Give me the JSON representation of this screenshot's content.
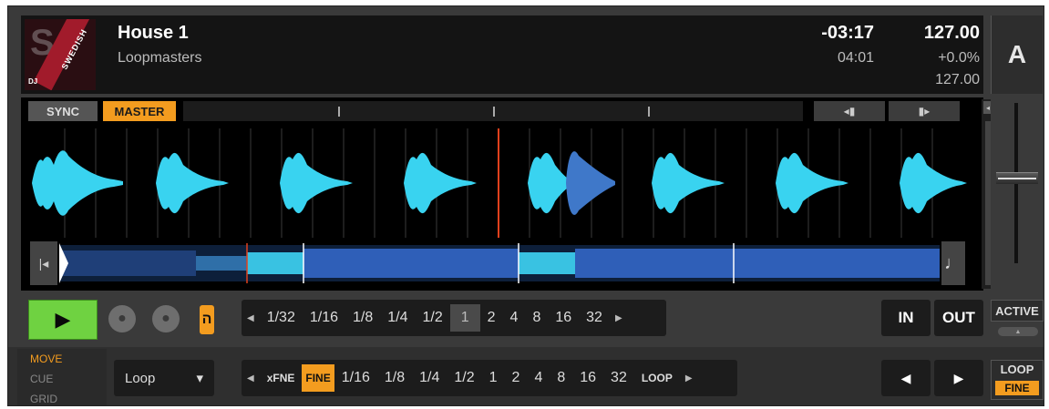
{
  "track": {
    "title": "House 1",
    "artist": "Loopmasters",
    "remaining": "-03:17",
    "elapsed": "04:01",
    "bpm": "127.00",
    "pitch": "+0.0%",
    "base_bpm": "127.00",
    "deck": "A"
  },
  "buttons": {
    "sync": "SYNC",
    "master": "MASTER",
    "nudge_back": "◂▮",
    "nudge_fwd": "▮▸",
    "overview_left": "|◂",
    "overview_right": "♩",
    "play": "▶",
    "flux": "ה",
    "in": "IN",
    "out": "OUT",
    "active": "ACTIVE"
  },
  "beatjump": {
    "items": [
      "1/32",
      "1/16",
      "1/8",
      "1/4",
      "1/2",
      "1",
      "2",
      "4",
      "8",
      "16",
      "32"
    ],
    "selected_index": 5
  },
  "modes": {
    "move": "MOVE",
    "cue": "CUE",
    "grid": "GRID"
  },
  "move_mode": {
    "value": "Loop",
    "dropdown_arrow": "▾"
  },
  "move_size": {
    "items": [
      "xFNE",
      "FINE",
      "1/16",
      "1/8",
      "1/4",
      "1/2",
      "1",
      "2",
      "4",
      "8",
      "16",
      "32",
      "LOOP"
    ],
    "highlight_index": 1
  },
  "move_arrows": {
    "left": "◀",
    "right": "▶"
  },
  "loop_button": {
    "label": "LOOP",
    "sub": "FINE"
  },
  "colors": {
    "accent": "#f39c1f",
    "play_green": "#6fd241",
    "waveform": "#39d3f0",
    "overview": "#2f5fb8"
  }
}
